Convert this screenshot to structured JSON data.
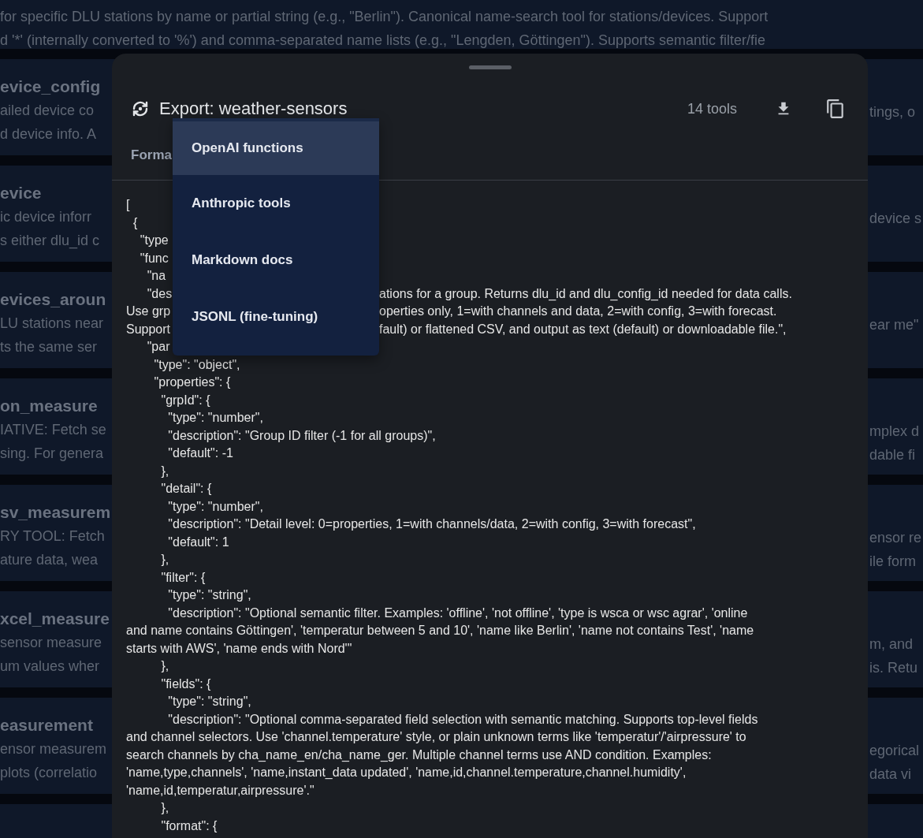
{
  "top_card": {
    "lines": [
      "for specific DLU stations by name or partial string (e.g., \"Berlin\"). Canonical name-search tool for stations/devices. Support",
      "d '*' (internally converted to '%') and comma-separated name lists (e.g., \"Lengden, Göttingen\"). Supports semantic filter/fie"
    ]
  },
  "background_cards": [
    {
      "left_title": "evice_config",
      "left_lines": [
        "ailed device co",
        "d device info. A"
      ],
      "right_lines": [
        "tings, o"
      ]
    },
    {
      "left_title": "evice",
      "left_lines": [
        "ic device inforr",
        "s either dlu_id c"
      ],
      "right_lines": [
        "device s"
      ]
    },
    {
      "left_title": "evices_aroun",
      "left_lines": [
        "LU stations near",
        "ts the same ser"
      ],
      "right_lines": [
        "ear me\""
      ]
    },
    {
      "left_title": "on_measure",
      "left_lines": [
        "IATIVE: Fetch se",
        "sing. For genera"
      ],
      "right_lines": [
        "mplex d",
        "dable fi"
      ]
    },
    {
      "left_title": "sv_measurem",
      "left_lines": [
        "RY TOOL: Fetch",
        "ature data, wea"
      ],
      "right_lines": [
        "ensor re",
        "ile form"
      ]
    },
    {
      "left_title": "xcel_measure",
      "left_lines": [
        "sensor measure",
        "um values wher"
      ],
      "right_lines": [
        "m, and",
        "is. Retu"
      ]
    },
    {
      "left_title": "easurement",
      "left_lines": [
        "ensor measurem",
        "plots (correlatio"
      ],
      "right_lines": [
        "egorical",
        "data vi"
      ]
    }
  ],
  "dialog": {
    "title": "Export: weather-sensors",
    "tool_count": "14 tools",
    "format_label": "Forma",
    "menu": [
      {
        "label": "OpenAI functions",
        "selected": true
      },
      {
        "label": "Anthropic tools",
        "selected": false
      },
      {
        "label": "Markdown docs",
        "selected": false
      },
      {
        "label": "JSONL (fine-tuning)",
        "selected": false
      }
    ],
    "code_lines": [
      {
        "text": "["
      },
      {
        "text": "  {"
      },
      {
        "text": "    \"type"
      },
      {
        "text": "    \"func"
      },
      {
        "text": "      \"na"
      },
      {
        "text": "      \"des",
        "right": "ations for a group. Returns dlu_id and dlu_config_id needed for data calls."
      },
      {
        "text": "Use grp",
        "right": "operties only, 1=with channels and data, 2=with config, 3=with forecast."
      },
      {
        "text": "Support",
        "right": "fault) or flattened CSV, and output as text (default) or downloadable file.\","
      },
      {
        "text": "      \"par"
      },
      {
        "text": "        \"type\": \"object\","
      },
      {
        "text": "        \"properties\": {"
      },
      {
        "text": "          \"grpId\": {"
      },
      {
        "text": "            \"type\": \"number\","
      },
      {
        "text": "            \"description\": \"Group ID filter (-1 for all groups)\","
      },
      {
        "text": "            \"default\": -1"
      },
      {
        "text": "          },"
      },
      {
        "text": "          \"detail\": {"
      },
      {
        "text": "            \"type\": \"number\","
      },
      {
        "text": "            \"description\": \"Detail level: 0=properties, 1=with channels/data, 2=with config, 3=with forecast\","
      },
      {
        "text": "            \"default\": 1"
      },
      {
        "text": "          },"
      },
      {
        "text": "          \"filter\": {"
      },
      {
        "text": "            \"type\": \"string\","
      },
      {
        "text": "            \"description\": \"Optional semantic filter. Examples: 'offline', 'not offline', 'type is wsca or wsc agrar', 'online"
      },
      {
        "text": "and name contains Göttingen', 'temperatur between 5 and 10', 'name like Berlin', 'name not contains Test', 'name"
      },
      {
        "text": "starts with AWS', 'name ends with Nord'\""
      },
      {
        "text": "          },"
      },
      {
        "text": "          \"fields\": {"
      },
      {
        "text": "            \"type\": \"string\","
      },
      {
        "text": "            \"description\": \"Optional comma-separated field selection with semantic matching. Supports top-level fields"
      },
      {
        "text": "and channel selectors. Use 'channel.temperature' style, or plain unknown terms like 'temperatur'/'airpressure' to"
      },
      {
        "text": "search channels by cha_name_en/cha_name_ger. Multiple channel terms use AND condition. Examples:"
      },
      {
        "text": "'name,type,channels', 'name,instant_data updated', 'name,id,channel.temperature,channel.humidity',"
      },
      {
        "text": "'name,id,temperatur,airpressure'.\""
      },
      {
        "text": "          },"
      },
      {
        "text": "          \"format\": {"
      }
    ]
  }
}
